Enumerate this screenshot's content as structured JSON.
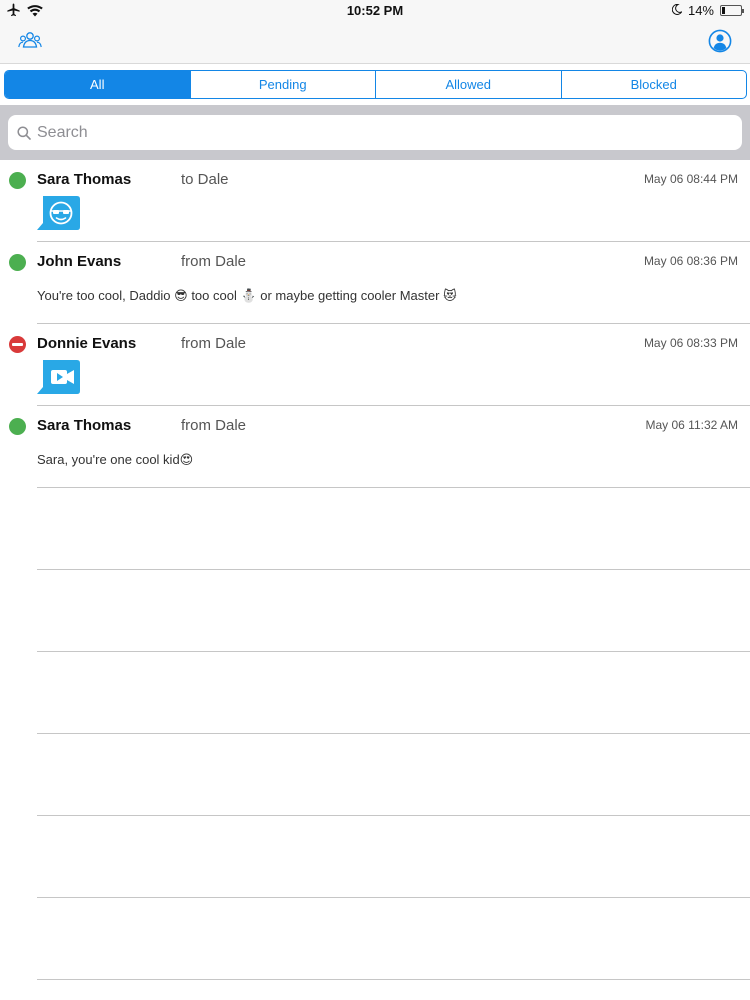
{
  "status_bar": {
    "time": "10:52 PM",
    "battery": "14%",
    "battery_level": 0.14,
    "left_icons": [
      "airplane-icon",
      "wifi-icon"
    ],
    "right_icons": [
      "moon-icon",
      "battery-icon"
    ]
  },
  "nav": {
    "left_icon": "contacts-group-icon",
    "right_icon": "profile-icon"
  },
  "tabs": [
    {
      "label": "All",
      "active": true
    },
    {
      "label": "Pending",
      "active": false
    },
    {
      "label": "Allowed",
      "active": false
    },
    {
      "label": "Blocked",
      "active": false
    }
  ],
  "search": {
    "placeholder": "Search",
    "value": ""
  },
  "messages": [
    {
      "sender": "Sara Thomas",
      "direction": "to Dale",
      "timestamp": "May 06 08:44 PM",
      "status": "allowed",
      "content_type": "sticker",
      "content_icon": "sticker-face-icon",
      "text": ""
    },
    {
      "sender": "John Evans",
      "direction": "from Dale",
      "timestamp": "May 06 08:36 PM",
      "status": "allowed",
      "content_type": "text",
      "text": "You're too cool, Daddio 😎 too cool ⛄ or maybe getting cooler Master 😻"
    },
    {
      "sender": "Donnie Evans",
      "direction": "from Dale",
      "timestamp": "May 06 08:33 PM",
      "status": "blocked",
      "content_type": "video",
      "content_icon": "video-message-icon",
      "text": ""
    },
    {
      "sender": "Sara Thomas",
      "direction": "from Dale",
      "timestamp": "May 06 11:32 AM",
      "status": "allowed",
      "content_type": "text",
      "text": "Sara, you're one cool kid😍"
    }
  ],
  "colors": {
    "accent": "#1386e6",
    "allowed": "#4caf50",
    "blocked": "#d93a3a",
    "search_bar_bg": "#c8c8cd",
    "nav_bg": "#f7f7f7"
  }
}
